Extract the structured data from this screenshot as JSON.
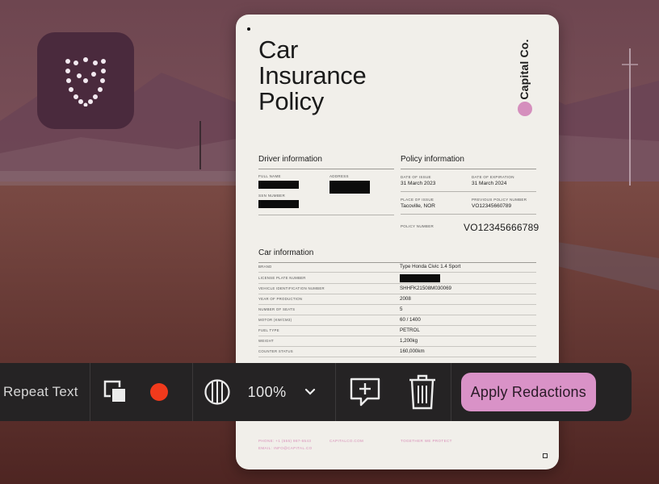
{
  "document": {
    "title": "Car\nInsurance\nPolicy",
    "brand": "Capital Co.",
    "driver_section": {
      "heading": "Driver information",
      "full_name_label": "FULL NAME",
      "address_label": "ADDRESS",
      "ssn_label": "SSN NUMBER"
    },
    "policy_section": {
      "heading": "Policy information",
      "issue_label": "DATE OF ISSUE",
      "issue_value": "31 March 2023",
      "expiration_label": "DATE OF EXPIRATION",
      "expiration_value": "31 March 2024",
      "place_label": "PLACE OF ISSUE",
      "place_value": "Tacoville, NOR",
      "prev_policy_label": "PREVIOUS POLICY NUMBER",
      "prev_policy_value": "VO12345660789",
      "policy_number_label": "POLICY NUMBER",
      "policy_number_value": "VO12345666789"
    },
    "car_section": {
      "heading": "Car information",
      "rows": [
        {
          "label": "BRAND",
          "value": "Type Honda Civic 1.4 Sport"
        },
        {
          "label": "LICENSE PLATE NUMBER",
          "value": ""
        },
        {
          "label": "VEHICLE IDENTIFICATION NUMBER",
          "value": "SHHFK21508M030069"
        },
        {
          "label": "YEAR OF PRODUCTION",
          "value": "2008"
        },
        {
          "label": "NUMBER OF SEATS",
          "value": "5"
        },
        {
          "label": "MOTOR (KW/CM3)",
          "value": "60 / 1400"
        },
        {
          "label": "FUEL TYPE",
          "value": "PETROL"
        },
        {
          "label": "WEIGHT",
          "value": "1,200kg"
        },
        {
          "label": "COUNTER STATUS",
          "value": "160,000km"
        }
      ]
    },
    "footer": {
      "phone": "PHONE: +1 (555) 987-6543",
      "email": "EMAIL: INFO@CAPITAL.CO",
      "site": "CAPITALCO.COM",
      "tagline": "TOGETHER WE PROTECT"
    }
  },
  "toolbar": {
    "repeat_text_label": "Repeat Text",
    "record_color": "#f03a1c",
    "zoom_value": "100%",
    "apply_label": "Apply Redactions",
    "icons": [
      "copy-icon",
      "record-dot-icon",
      "contrast-icon",
      "chevron-down-icon",
      "add-comment-icon",
      "trash-icon"
    ]
  },
  "app_icon": {
    "name": "shield-icon",
    "background": "#4a2a3d"
  },
  "colors": {
    "accent_pink": "#d992c7",
    "toolbar_bg": "#252324"
  }
}
